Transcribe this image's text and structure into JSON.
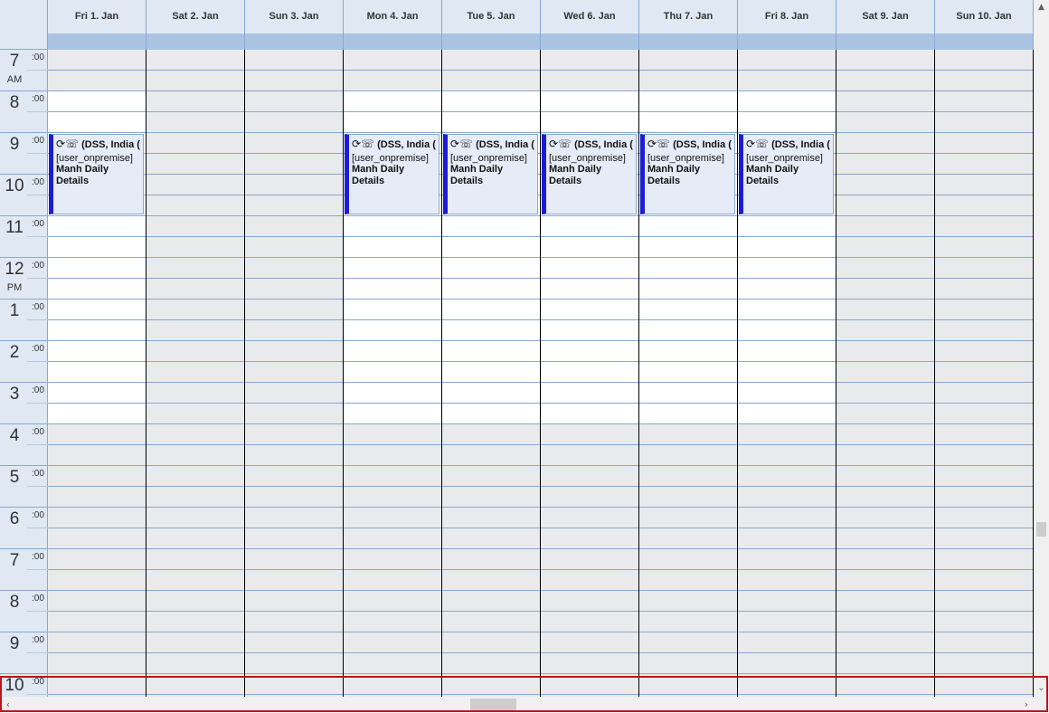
{
  "days": [
    {
      "label": "Fri 1. Jan"
    },
    {
      "label": "Sat 2. Jan"
    },
    {
      "label": "Sun 3. Jan"
    },
    {
      "label": "Mon 4. Jan"
    },
    {
      "label": "Tue 5. Jan"
    },
    {
      "label": "Wed 6. Jan"
    },
    {
      "label": "Thu 7. Jan"
    },
    {
      "label": "Fri 8. Jan"
    },
    {
      "label": "Sat 9. Jan"
    },
    {
      "label": "Sun 10. Jan"
    }
  ],
  "hours": [
    {
      "hour": "7",
      "minutes": ":00",
      "ampm": "AM"
    },
    {
      "hour": "8",
      "minutes": ":00",
      "ampm": ""
    },
    {
      "hour": "9",
      "minutes": ":00",
      "ampm": ""
    },
    {
      "hour": "10",
      "minutes": ":00",
      "ampm": ""
    },
    {
      "hour": "11",
      "minutes": ":00",
      "ampm": ""
    },
    {
      "hour": "12",
      "minutes": ":00",
      "ampm": "PM"
    },
    {
      "hour": "1",
      "minutes": ":00",
      "ampm": ""
    },
    {
      "hour": "2",
      "minutes": ":00",
      "ampm": ""
    },
    {
      "hour": "3",
      "minutes": ":00",
      "ampm": ""
    },
    {
      "hour": "4",
      "minutes": ":00",
      "ampm": ""
    },
    {
      "hour": "5",
      "minutes": ":00",
      "ampm": ""
    },
    {
      "hour": "6",
      "minutes": ":00",
      "ampm": ""
    },
    {
      "hour": "7",
      "minutes": ":00",
      "ampm": ""
    },
    {
      "hour": "8",
      "minutes": ":00",
      "ampm": ""
    },
    {
      "hour": "9",
      "minutes": ":00",
      "ampm": ""
    },
    {
      "hour": "10",
      "minutes": ":00",
      "ampm": ""
    }
  ],
  "appointment": {
    "icons": "⟳☏",
    "location": "(DSS, India (",
    "organizer": "[user_onpremise]",
    "subject": "Manh Daily Details"
  },
  "appointment_days": [
    "Fri 1. Jan",
    "Mon 4. Jan",
    "Tue 5. Jan",
    "Wed 6. Jan",
    "Thu 7. Jan",
    "Fri 8. Jan"
  ],
  "scrollbars": {
    "up_icon": "chevron-up-icon",
    "down_icon": "chevron-down-icon",
    "left_icon": "chevron-left-icon",
    "right_icon": "chevron-right-icon"
  },
  "colors": {
    "header_bg": "#dfe8f3",
    "allday_bg": "#aac3e3",
    "nonwork_bg": "#e9eaeb",
    "work_bg": "#ffffff",
    "appt_bg": "#e6ecf7",
    "appt_bar": "#1c1cd8",
    "highlight": "#c0141c"
  }
}
